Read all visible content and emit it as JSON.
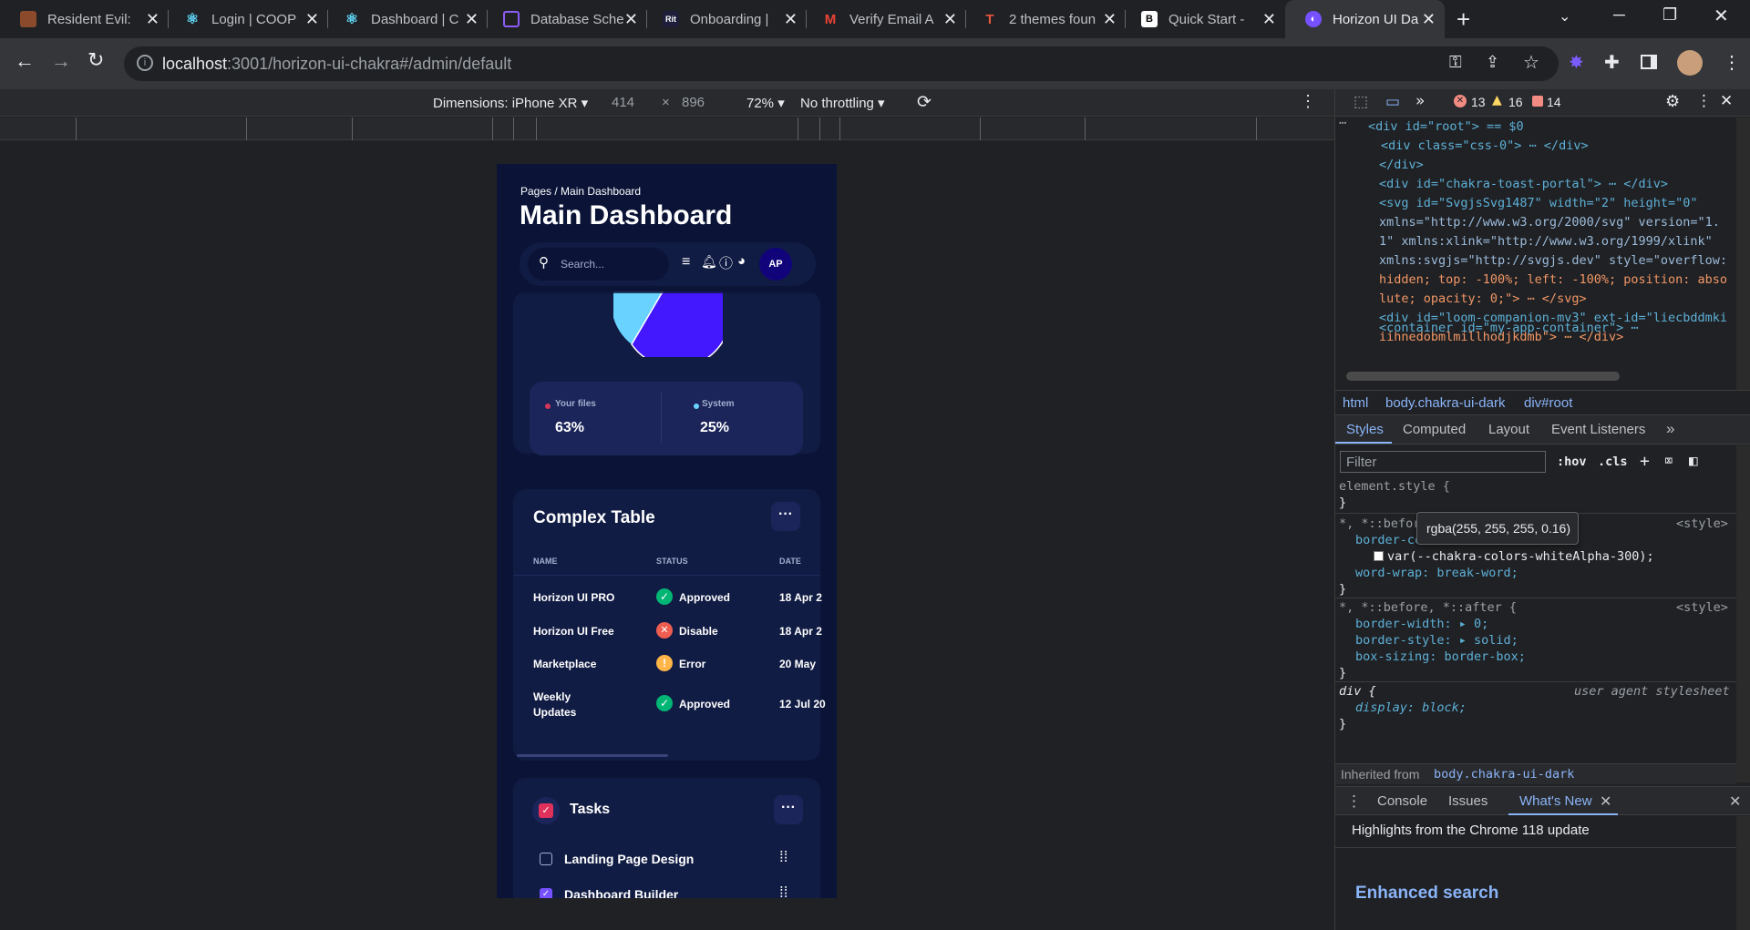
{
  "tabs": [
    {
      "label": "Resident Evil:",
      "color": "#8b4a2b",
      "glyph": ""
    },
    {
      "label": "Login | COOP",
      "color": "#61dafb",
      "glyph": "⚛"
    },
    {
      "label": "Dashboard | C",
      "color": "#61dafb",
      "glyph": "⚛"
    },
    {
      "label": "Database Sche",
      "color": "#7c3aed",
      "glyph": "▭"
    },
    {
      "label": "Onboarding |",
      "color": "#1e1e3a",
      "glyph": "Rit"
    },
    {
      "label": "Verify Email A",
      "color": "#ea4335",
      "glyph": "M"
    },
    {
      "label": "2 themes foun",
      "color": "#e8553d",
      "glyph": "T"
    },
    {
      "label": "Quick Start - ",
      "color": "#ffffff",
      "glyph": "B"
    },
    {
      "label": "Horizon UI Da",
      "color": "#7551ff",
      "glyph": "◐"
    }
  ],
  "browser": {
    "url_host": "localhost",
    "url_rest": ":3001/horizon-ui-chakra#/admin/default"
  },
  "device_toolbar": {
    "dimensions": "Dimensions: iPhone XR ▾",
    "width": "414",
    "times": "×",
    "height": "896",
    "zoom": "72% ▾",
    "throttling": "No throttling ▾"
  },
  "dashboard": {
    "breadcrumb": "Pages  /  Main Dashboard",
    "title": "Main Dashboard",
    "search_placeholder": "Search...",
    "avatar": "AP",
    "pie": {
      "legend": [
        {
          "label": "Your files",
          "value": "63%",
          "color": "#d3375a"
        },
        {
          "label": "System",
          "value": "25%",
          "color": "#6ad2ff"
        }
      ]
    },
    "complex_table": {
      "title": "Complex Table",
      "columns": [
        "NAME",
        "STATUS",
        "DATE"
      ],
      "rows": [
        {
          "name": "Horizon UI PRO",
          "status": "Approved",
          "date": "18 Apr 2",
          "icon": "check"
        },
        {
          "name": "Horizon UI Free",
          "status": "Disable",
          "date": "18 Apr 2",
          "icon": "cross"
        },
        {
          "name": "Marketplace",
          "status": "Error",
          "date": "20 May",
          "icon": "warn"
        },
        {
          "name": "Weekly\nUpdates",
          "status": "Approved",
          "date": "12 Jul 20",
          "icon": "check"
        }
      ]
    },
    "tasks": {
      "title": "Tasks",
      "items": [
        {
          "label": "Landing Page Design",
          "checked": false
        },
        {
          "label": "Dashboard Builder",
          "checked": true
        }
      ]
    }
  },
  "devtools": {
    "errors": "13",
    "warnings": "16",
    "issues": "14",
    "dom_lines": [
      "<div id=\"root\"> == $0",
      "<div class=\"css-0\"> ⋯ </div>",
      "</div>",
      "<div id=\"chakra-toast-portal\"> ⋯ </div>",
      "<svg id=\"SvgjsSvg1487\" width=\"2\" height=\"0\"",
      "xmlns=\"http://www.w3.org/2000/svg\" version=\"1.",
      "1\" xmlns:xlink=\"http://www.w3.org/1999/xlink\"",
      "xmlns:svgjs=\"http://svgjs.dev\" style=\"overflow:",
      "hidden; top: -100%; left: -100%; position: abso",
      "lute; opacity: 0;\"> ⋯ </svg>",
      "<div id=\"loom-companion-mv3\" ext-id=\"liecbddmki",
      "iihnedobmlmillhodjkdmb\"> ⋯ </div>",
      "<container id=\"my-app-container\"> ⋯"
    ],
    "breadcrumbs": [
      "html",
      "body.chakra-ui-dark",
      "div#root"
    ],
    "panel_tabs": [
      "Styles",
      "Computed",
      "Layout",
      "Event Listeners"
    ],
    "filter_placeholder": "Filter",
    "hov": ":hov",
    "cls": ".cls",
    "tooltip": "rgba(255, 255, 255, 0.16)",
    "style_lines": [
      "element.style {",
      "}",
      "*, *::befor",
      "border-color: ▸",
      "var(--chakra-colors-whiteAlpha-300);",
      "word-wrap: break-word;",
      "}",
      "*, *::before, *::after {",
      "border-width: ▸ 0;",
      "border-style: ▸ solid;",
      "box-sizing: border-box;",
      "}",
      "div {",
      "display: block;",
      "}"
    ],
    "style_source": "<style>",
    "ua_stylesheet": "user agent stylesheet",
    "inherited_label": "Inherited from",
    "inherited_from": "body.chakra-ui-dark",
    "drawer_tabs": [
      "Console",
      "Issues",
      "What's New"
    ],
    "whats_new_heading": "Highlights from the Chrome 118 update",
    "enhanced_search": "Enhanced search"
  }
}
